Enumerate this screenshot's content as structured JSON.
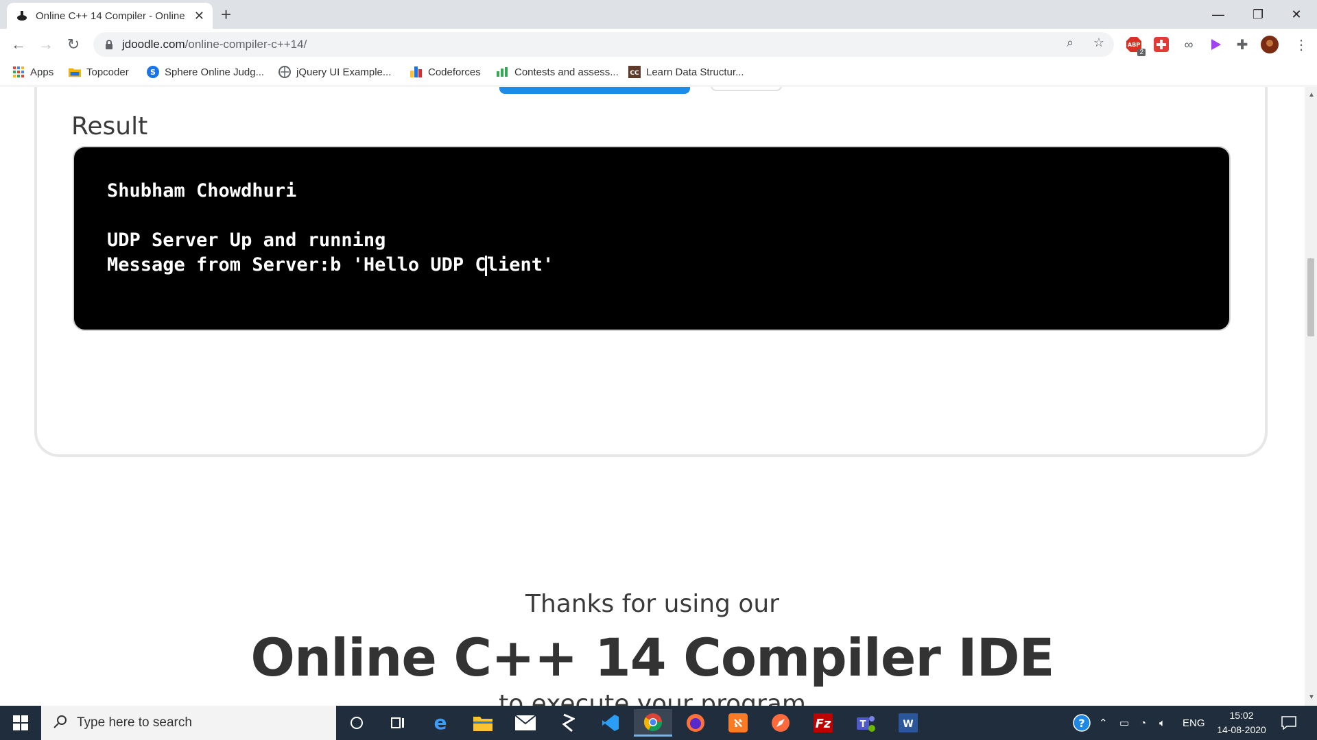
{
  "browser": {
    "tab_title": "Online C++ 14 Compiler - Online",
    "new_tab_label": "+",
    "url_domain": "jdoodle.com",
    "url_path": "/online-compiler-c++14/",
    "extension_badge": "2"
  },
  "bookmarks": [
    {
      "label": "Apps",
      "icon": "apps-grid-icon",
      "color": "#ea4335"
    },
    {
      "label": "Topcoder",
      "icon": "folder-icon",
      "color": "#f4b400"
    },
    {
      "label": "Sphere Online Judg...",
      "icon": "sphere-icon",
      "color": "#1a73e8"
    },
    {
      "label": "jQuery UI Example...",
      "icon": "globe-icon",
      "color": "#5f6368"
    },
    {
      "label": "Codeforces",
      "icon": "codeforces-icon",
      "color": "#1a73e8"
    },
    {
      "label": "Contests and assess...",
      "icon": "chart-icon",
      "color": "#34a853"
    },
    {
      "label": "Learn Data Structur...",
      "icon": "cc-icon",
      "color": "#5f3b2b"
    }
  ],
  "page": {
    "result_label": "Result",
    "console_lines": [
      "Shubham Chowdhuri",
      "",
      "UDP Server Up and running",
      "Message from Server:b 'Hello UDP C",
      "lient'"
    ],
    "thanks_line1": "Thanks for using our",
    "thanks_line2": "Online C++ 14 Compiler IDE",
    "thanks_line3": "to execute your program"
  },
  "taskbar": {
    "search_placeholder": "Type here to search",
    "lang": "ENG",
    "time": "15:02",
    "date": "14-08-2020"
  },
  "colors": {
    "run_button": "#1b8ce8",
    "console_bg": "#000000",
    "taskbar_bg": "#1f2d3d"
  }
}
